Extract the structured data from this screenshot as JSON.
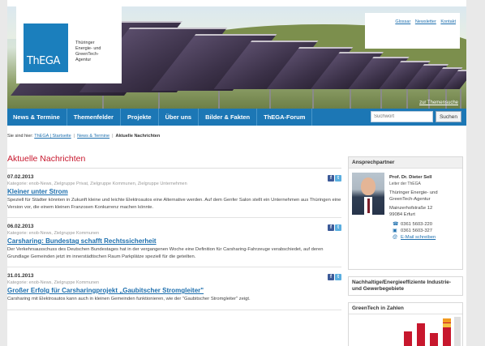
{
  "header": {
    "logo_text": "ThEGA",
    "logo_tagline": [
      "Thüringer",
      "Energie- und",
      "GreenTech-",
      "Agentur"
    ],
    "top_links": [
      "Glossar",
      "Newsletter",
      "Kontakt"
    ],
    "themen_link": "zur Themensuche"
  },
  "nav": {
    "items": [
      "News & Termine",
      "Themenfelder",
      "Projekte",
      "Über uns",
      "Bilder & Fakten",
      "ThEGA-Forum"
    ],
    "search_placeholder": "Suchwort",
    "search_button": "Suchen"
  },
  "breadcrumb": {
    "prefix": "Sie sind hier:",
    "links": [
      "ThEGA | Startseite",
      "News & Termine"
    ],
    "current": "Aktuelle Nachrichten"
  },
  "main": {
    "title": "Aktuelle Nachrichten",
    "news": [
      {
        "date": "07.02.2013",
        "category": "Kategorie: enob-News, Zielgruppe Privat, Zielgruppe Kommunen, Zielgruppe Unternehmen",
        "title": "Kleiner unter Strom",
        "text": "Speziell für Städter könnten in Zukunft kleine und leichte Elektroautos eine Alternative werden. Auf dem Genfer Salon stellt ein Unternehmen aus Thüringen eine Version vor, die einem kleinen Franzosen Konkurrenz machen könnte."
      },
      {
        "date": "06.02.2013",
        "category": "Kategorie: enob-News, Zielgruppe Kommunen",
        "title": "Carsharing: Bundestag schafft Rechtssicherheit",
        "text": "Der Verkehrsausschuss des Deutschen Bundestages hat in der vergangenen Woche eine Definition für Carsharing-Fahrzeuge verabschiedet, auf deren Grundlage Gemeinden jetzt im innerstädtischen Raum Parkplätze speziell für die geteilten."
      },
      {
        "date": "31.01.2013",
        "category": "Kategorie: enob-News, Zielgruppe Kommunen",
        "title": "Großer Erfolg für Carsharingprojekt „Gaubitscher Stromgleiter\"",
        "text": "Carsharing mit Elektroautos kann auch in kleinen Gemeinden funktionieren, wie der \"Gaubitscher Stromgleiter\" zeigt."
      }
    ]
  },
  "sidebar": {
    "contact": {
      "title": "Ansprechpartner",
      "name": "Prof. Dr. Dieter Sell",
      "role": "Leiter der ThEGA",
      "org": [
        "Thüringer Energie- und",
        "GreenTech-Agentur"
      ],
      "address": [
        "Mainzerhofstraße 12",
        "99084 Erfurt"
      ],
      "phone": "0361 5603-220",
      "fax": "0361 5603-327",
      "email": "E-Mail schreiben"
    },
    "industry_title": "Nachhaltige/Energieeffiziente Industrie- und Gewerbegebiete",
    "greentech_title": "GreenTech in Zahlen"
  },
  "colors": {
    "brand_blue": "#1c77b5",
    "headline_red": "#c7172d",
    "link_blue": "#1d6fae"
  }
}
